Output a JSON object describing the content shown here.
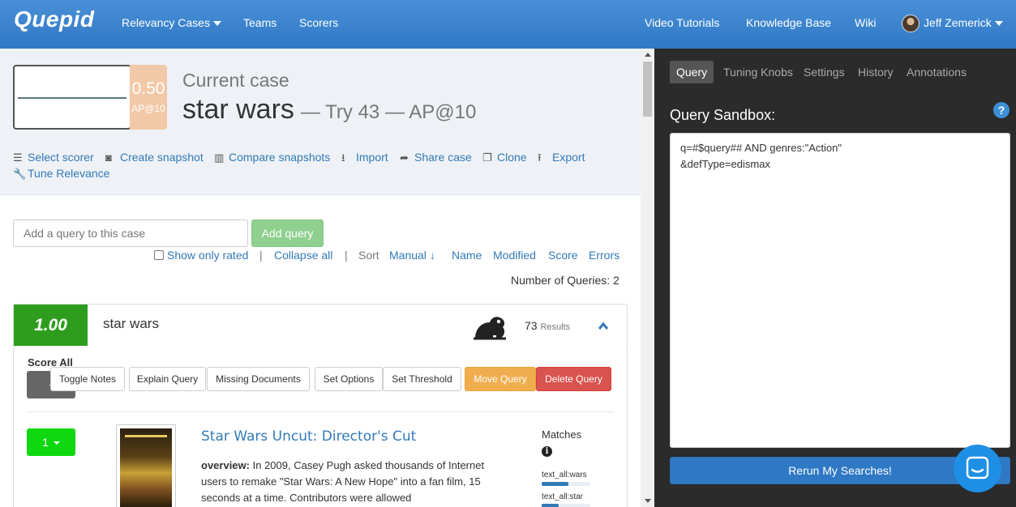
{
  "nav": {
    "brand": "Quepid",
    "relevancy_cases": "Relevancy Cases",
    "teams": "Teams",
    "scorers": "Scorers",
    "video_tutorials": "Video Tutorials",
    "knowledge_base": "Knowledge Base",
    "wiki": "Wiki",
    "user": "Jeff Zemerick"
  },
  "case": {
    "score": "0.50",
    "metric": "AP@10",
    "label": "Current case",
    "name": "star wars",
    "try_text": "— Try 43 — AP@10"
  },
  "actions": {
    "select_scorer": "Select scorer",
    "create_snapshot": "Create snapshot",
    "compare_snapshots": "Compare snapshots",
    "import": "Import",
    "share_case": "Share case",
    "clone": "Clone",
    "export": "Export",
    "tune_relevance": "Tune Relevance"
  },
  "query_add": {
    "placeholder": "Add a query to this case",
    "button": "Add query"
  },
  "sort_bar": {
    "show_only_rated": "Show only rated",
    "collapse_all": "Collapse all",
    "sort_label": "Sort",
    "manual": "Manual",
    "name": "Name",
    "modified": "Modified",
    "score": "Score",
    "errors": "Errors",
    "num_queries": "Number of Queries: 2"
  },
  "query": {
    "score": "1.00",
    "text": "star wars",
    "results_count": "73",
    "results_label": "Results",
    "score_all": "Score All",
    "score_all_btn": "-",
    "buttons": {
      "toggle_notes": "Toggle Notes",
      "explain_query": "Explain Query",
      "missing_documents": "Missing Documents",
      "set_options": "Set Options",
      "set_threshold": "Set Threshold",
      "move_query": "Move Query",
      "delete_query": "Delete Query"
    }
  },
  "doc": {
    "rating": "1",
    "title": "Star Wars Uncut: Director's Cut",
    "desc_label": "overview:",
    "desc_text": "In 2009, Casey Pugh asked thousands of Internet users to remake \"Star Wars: A New Hope\" into a fan film, 15 seconds at a time. Contributors were allowed",
    "matches_label": "Matches",
    "match_fields": [
      {
        "name": "text_all:wars",
        "level": 0.55
      },
      {
        "name": "text_all:star",
        "level": 0.35
      }
    ]
  },
  "sidebar": {
    "tabs": [
      "Query",
      "Tuning Knobs",
      "Settings",
      "History",
      "Annotations"
    ],
    "sandbox_title": "Query Sandbox:",
    "sandbox_value": "q=#$query## AND genres:\"Action\"\n&defType=edismax",
    "rerun": "Rerun My Searches!"
  },
  "colors": {
    "nav_blue": "#2f78c4",
    "case_score_bg": "#f2c9a6",
    "query_score_bg": "#2e9d1e",
    "rating_green": "#10d810",
    "move_orange": "#f0ad4e",
    "delete_red": "#d9534f",
    "sidebar_bg": "#2b2b2b"
  }
}
